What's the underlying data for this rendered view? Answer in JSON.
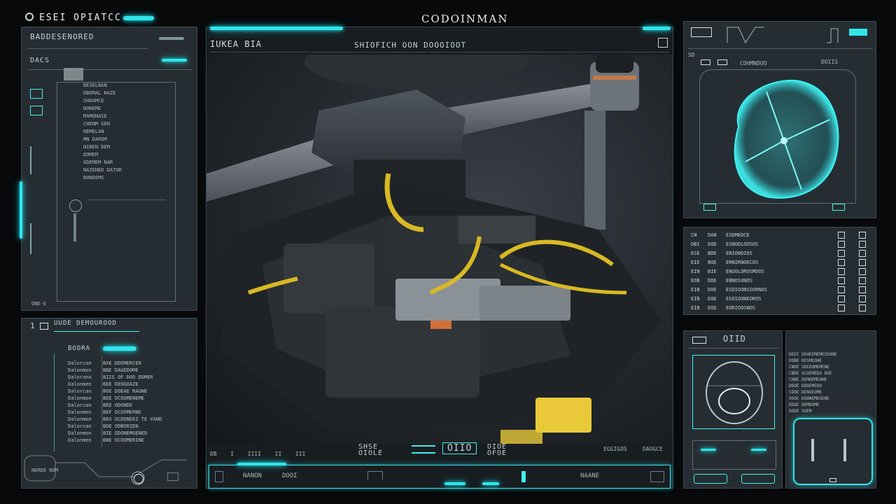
{
  "header": {
    "app_title": "ESEI OPIATCC",
    "center_title": "CODOINMAN"
  },
  "left_top_panel": {
    "title": "BADDESENORED",
    "subtitle": "DACS",
    "footer": "ONE-E",
    "rows": [
      "BESELNAN",
      "DBOMAL NAZE",
      "SHDAMCE",
      "NONEME",
      "MAMONASE",
      "CHENM GEN",
      "NEMELAN",
      "MN DAROM",
      "NIBEN DEM",
      "DOMEM",
      "GDEMEM NAR",
      "NAZENED DATOR",
      "BONDEMS"
    ]
  },
  "left_bottom_panel": {
    "index": "1",
    "title": "UUDE DEMOUROOD",
    "subtitle": "BODRA",
    "progress": 0.5,
    "rows": [
      [
        "Dalorcon",
        "BXE DDOMERCER"
      ],
      [
        "Dalonmon",
        "BBE DAGEDOME"
      ],
      [
        "Dalorano",
        "BIIS OF DOO DOMER"
      ],
      [
        "Dalonmen",
        "BEE DEOGOAZE"
      ],
      [
        "Dalorcan",
        "BOE DOEAE RAGNE"
      ],
      [
        "Dalonmon",
        "BEE OCOOMENEME"
      ],
      [
        "Dalarcan",
        "BEE ODONDE"
      ],
      [
        "Dalonmen",
        "BEF OCOOMERNE"
      ],
      [
        "Dalonmon",
        "BEX OCDONDEZ TE VAND"
      ],
      [
        "Dalarcan",
        "BOE ODBORZEN"
      ],
      [
        "Dalonmon",
        "BIE ODONEMGENED"
      ],
      [
        "Dalonmen",
        "BBE OCOOMERINE"
      ]
    ],
    "footer_label": "NERDE NOM"
  },
  "viewer": {
    "left_header": "IUKEA BIA",
    "center_header": "SHIOFICH OON DOOOIOOT",
    "bottom_badge_left": "SHSE OIOLE",
    "bottom_badge_center": "OIIO",
    "bottom_badge_right": "OIOE OFOE",
    "bottom_left_codes": [
      "DB",
      "I",
      "IIII",
      "II",
      "III"
    ],
    "bottom_right_codes": [
      "EGGIGOS",
      "DAOGCE"
    ],
    "timeline_left": "NANON",
    "timeline_left2": "DOOI",
    "timeline_right": "NAANE",
    "play_progress": 0.12
  },
  "right_top_panel": {
    "index": "SD",
    "label_left": "CDHMNDOO",
    "label_right": "DOIIS"
  },
  "right_middle_panel": {
    "rows": [
      [
        "CN",
        "DAN",
        "ESDMEDCE"
      ],
      [
        "DBI",
        "DOD",
        "ESNODLOOSOS"
      ],
      [
        "ESE",
        "BDE",
        "ENIONOIOS"
      ],
      [
        "EIE",
        "BOE",
        "ERNIRNOECOS"
      ],
      [
        "EIN",
        "BIE",
        "ENUOLOROSMOOS"
      ],
      [
        "EOB",
        "DDE",
        "EBNOSUNOS"
      ],
      [
        "EIB",
        "DOE",
        "ESOIOONSSORNOS"
      ],
      [
        "EIB",
        "DOE",
        "ESOIOONEOROS"
      ],
      [
        "EIB",
        "DOE",
        "EORIOOSNOS"
      ]
    ]
  },
  "right_bottom_left_panel": {
    "title": "OIID"
  },
  "right_bottom_right_panel": {
    "rows": [
      "DEEI SEHEEMEMESSONE",
      "DOBE DESMEONE",
      "CNDE SDEOOMEMENE",
      "CBDE SCOEMEDO DOE",
      "CHBE DEMOEMEONE",
      "DDOE ODOEMEDO",
      "CDDE DENOEOME",
      "OOOE DOONEMEGENE",
      "DDOE OEMDOME",
      "OODE SOEM"
    ]
  },
  "colors": {
    "accent": "#2fe6ec",
    "panel": "#262d32",
    "background": "#07090b",
    "wire": "#d9b924"
  }
}
